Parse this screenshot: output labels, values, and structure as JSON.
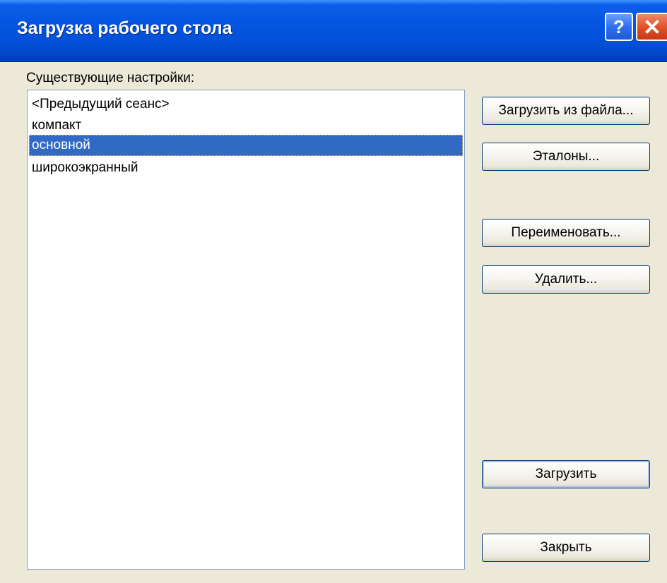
{
  "window": {
    "title": "Загрузка рабочего стола",
    "help_glyph": "?",
    "icons": {
      "help": "help-icon",
      "close": "close-icon"
    }
  },
  "settings": {
    "label": "Существующие настройки:",
    "items": [
      {
        "label": "<Предыдущий сеанс>",
        "selected": false
      },
      {
        "label": "компакт",
        "selected": false
      },
      {
        "label": "основной",
        "selected": true
      },
      {
        "label": "широкоэкранный",
        "selected": false
      }
    ]
  },
  "buttons": {
    "load_from_file": "Загрузить из файла...",
    "defaults": "Эталоны...",
    "rename": "Переименовать...",
    "delete": "Удалить...",
    "load": "Загрузить",
    "close": "Закрыть"
  },
  "colors": {
    "titlebar": "#0454e0",
    "selection": "#316ac5",
    "dialog_bg": "#ece9d8",
    "close_button": "#e2542a"
  }
}
